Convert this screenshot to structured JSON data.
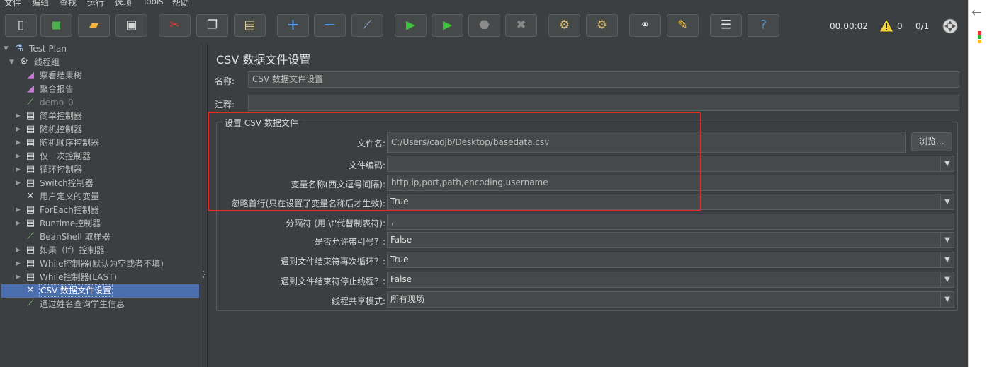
{
  "menu": [
    "文件",
    "编辑",
    "查找",
    "运行",
    "选项",
    "Tools",
    "帮助"
  ],
  "toolbar": {
    "timer": "00:00:02",
    "warnings": "0",
    "threads": "0/1"
  },
  "tree": [
    {
      "label": "Test Plan",
      "icon": "flask-icon",
      "expanded": true
    },
    {
      "label": "线程组",
      "icon": "gear-icon",
      "expanded": true
    },
    {
      "label": "察看结果树",
      "icon": "chart-icon"
    },
    {
      "label": "聚合报告",
      "icon": "chart-icon"
    },
    {
      "label": "demo_0",
      "icon": "pipette-icon",
      "disabled": true
    },
    {
      "label": "简单控制器",
      "icon": "controller-icon"
    },
    {
      "label": "随机控制器",
      "icon": "controller-icon"
    },
    {
      "label": "随机顺序控制器",
      "icon": "controller-icon"
    },
    {
      "label": "仅一次控制器",
      "icon": "controller-icon"
    },
    {
      "label": "循环控制器",
      "icon": "controller-icon"
    },
    {
      "label": "Switch控制器",
      "icon": "controller-icon"
    },
    {
      "label": "用户定义的变量",
      "icon": "wrench-icon"
    },
    {
      "label": "ForEach控制器",
      "icon": "controller-icon"
    },
    {
      "label": "Runtime控制器",
      "icon": "controller-icon"
    },
    {
      "label": "BeanShell 取样器",
      "icon": "pipette-icon"
    },
    {
      "label": "如果（If）控制器",
      "icon": "controller-icon"
    },
    {
      "label": "While控制器(默认为空或者不填)",
      "icon": "controller-icon"
    },
    {
      "label": "While控制器(LAST)",
      "icon": "controller-icon"
    },
    {
      "label": "CSV 数据文件设置",
      "icon": "wrench-icon",
      "selected": true
    },
    {
      "label": "通过姓名查询学生信息",
      "icon": "pipette-icon"
    }
  ],
  "content": {
    "title": "CSV 数据文件设置",
    "name_label": "名称:",
    "name_value": "CSV 数据文件设置",
    "comment_label": "注释:",
    "comment_value": "",
    "group_title": "设置 CSV 数据文件",
    "filename_label": "文件名:",
    "filename_value": "C:/Users/caojb/Desktop/basedata.csv",
    "browse_label": "浏览...",
    "encoding_label": "文件编码:",
    "encoding_value": "",
    "varnames_label": "变量名称(西文逗号间隔):",
    "varnames_value": "http,ip,port,path,encoding,username",
    "ignore_first_label": "忽略首行(只在设置了变量名称后才生效):",
    "ignore_first_value": "True",
    "delimiter_label": "分隔符 (用'\\t'代替制表符):",
    "delimiter_value": ",",
    "quoted_label": "是否允许带引号？:",
    "quoted_value": "False",
    "recycle_label": "遇到文件结束符再次循环？:",
    "recycle_value": "True",
    "stop_thread_label": "遇到文件结束符停止线程？:",
    "stop_thread_value": "False",
    "sharing_label": "线程共享模式:",
    "sharing_value": "所有现场"
  },
  "colors": {
    "background": "#3c3f41",
    "selection": "#4b6eaf",
    "highlight_border": "#e22b2b"
  }
}
